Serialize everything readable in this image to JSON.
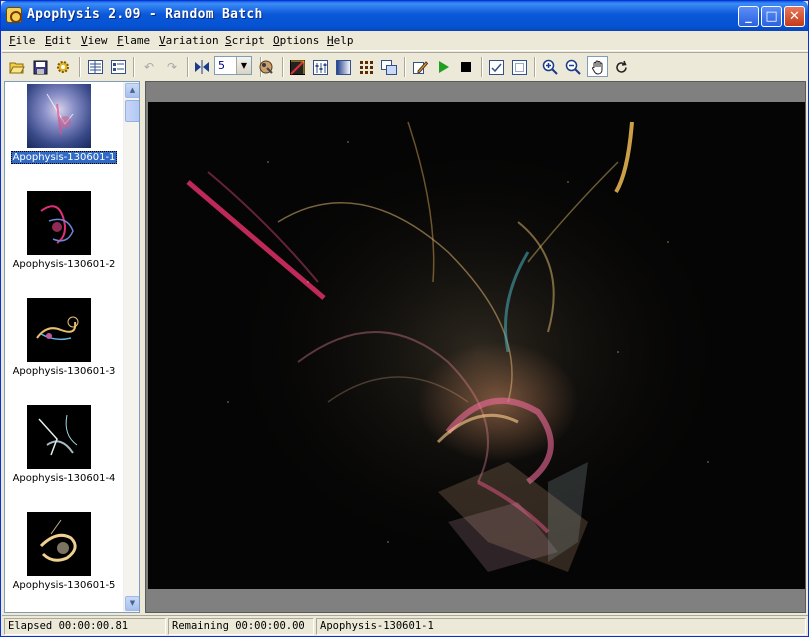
{
  "window": {
    "title": "Apophysis 2.09 - Random Batch"
  },
  "title_buttons": {
    "minimize": "_",
    "maximize": "□",
    "close": "✕"
  },
  "menu": [
    "File",
    "Edit",
    "View",
    "Flame",
    "Variation",
    "Script",
    "Options",
    "Help"
  ],
  "toolbar": {
    "density_value": "5",
    "icons": [
      "open-icon",
      "save-icon",
      "gear-icon",
      "list-view-icon",
      "icon-view-icon",
      "undo-icon",
      "redo-icon",
      "mirror-icon",
      "density-icon",
      "transform-editor-icon",
      "adjust-icon",
      "gradient-icon",
      "mutate-icon",
      "export-icon",
      "edit-script-icon",
      "run-script-icon",
      "stop-script-icon",
      "show-transforms-icon",
      "select-icon",
      "zoom-in-icon",
      "zoom-out-icon",
      "pan-icon",
      "rotate-icon"
    ]
  },
  "flames": [
    {
      "name": "Apophysis-130601-1",
      "selected": true
    },
    {
      "name": "Apophysis-130601-2",
      "selected": false
    },
    {
      "name": "Apophysis-130601-3",
      "selected": false
    },
    {
      "name": "Apophysis-130601-4",
      "selected": false
    },
    {
      "name": "Apophysis-130601-5",
      "selected": false
    }
  ],
  "status": {
    "elapsed": "Elapsed 00:00:00.81",
    "remaining": "Remaining 00:00:00.00",
    "flame": "Apophysis-130601-1"
  },
  "colors": {
    "titlebar": "#0a58d8",
    "selection": "#316ac5",
    "background": "#ece9d8",
    "render_bg": "#050505"
  }
}
